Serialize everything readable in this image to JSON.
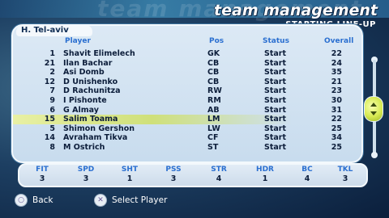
{
  "header": {
    "title": "team management",
    "subtitle": "STARTING LINE-UP"
  },
  "team": {
    "name": "H. Tel-aviv"
  },
  "columns": {
    "player": "Player",
    "pos": "Pos",
    "status": "Status",
    "overall": "Overall"
  },
  "players": [
    {
      "num": "1",
      "name": "Shavit Elimelech",
      "pos": "GK",
      "status": "Start",
      "overall": "22"
    },
    {
      "num": "21",
      "name": "Ilan Bachar",
      "pos": "CB",
      "status": "Start",
      "overall": "24"
    },
    {
      "num": "2",
      "name": "Asi Domb",
      "pos": "CB",
      "status": "Start",
      "overall": "35"
    },
    {
      "num": "12",
      "name": "D Unishenko",
      "pos": "CB",
      "status": "Start",
      "overall": "21"
    },
    {
      "num": "7",
      "name": "D Rachunitza",
      "pos": "RW",
      "status": "Start",
      "overall": "23"
    },
    {
      "num": "9",
      "name": "I Pishonte",
      "pos": "RM",
      "status": "Start",
      "overall": "30"
    },
    {
      "num": "6",
      "name": "G Almay",
      "pos": "AB",
      "status": "Start",
      "overall": "31"
    },
    {
      "num": "15",
      "name": "Salim Toama",
      "pos": "LM",
      "status": "Start",
      "overall": "22"
    },
    {
      "num": "5",
      "name": "Shimon Gershon",
      "pos": "LW",
      "status": "Start",
      "overall": "25"
    },
    {
      "num": "14",
      "name": "Avraham Tikva",
      "pos": "CF",
      "status": "Start",
      "overall": "34"
    },
    {
      "num": "8",
      "name": "M Ostrich",
      "pos": "ST",
      "status": "Start",
      "overall": "25"
    }
  ],
  "selected_player_index": 7,
  "stats": [
    {
      "label": "FIT",
      "value": "3"
    },
    {
      "label": "SPD",
      "value": "3"
    },
    {
      "label": "SHT",
      "value": "1"
    },
    {
      "label": "PSS",
      "value": "3"
    },
    {
      "label": "STR",
      "value": "4"
    },
    {
      "label": "HDR",
      "value": "1"
    },
    {
      "label": "BC",
      "value": "4"
    },
    {
      "label": "TKL",
      "value": "3"
    }
  ],
  "footer": {
    "back_label": "Back",
    "select_label": "Select Player",
    "back_icon": "circle-button-icon",
    "select_icon": "cross-button-icon"
  },
  "colors": {
    "accent": "#2a6fd0",
    "selected_row": "#d7ea52"
  }
}
